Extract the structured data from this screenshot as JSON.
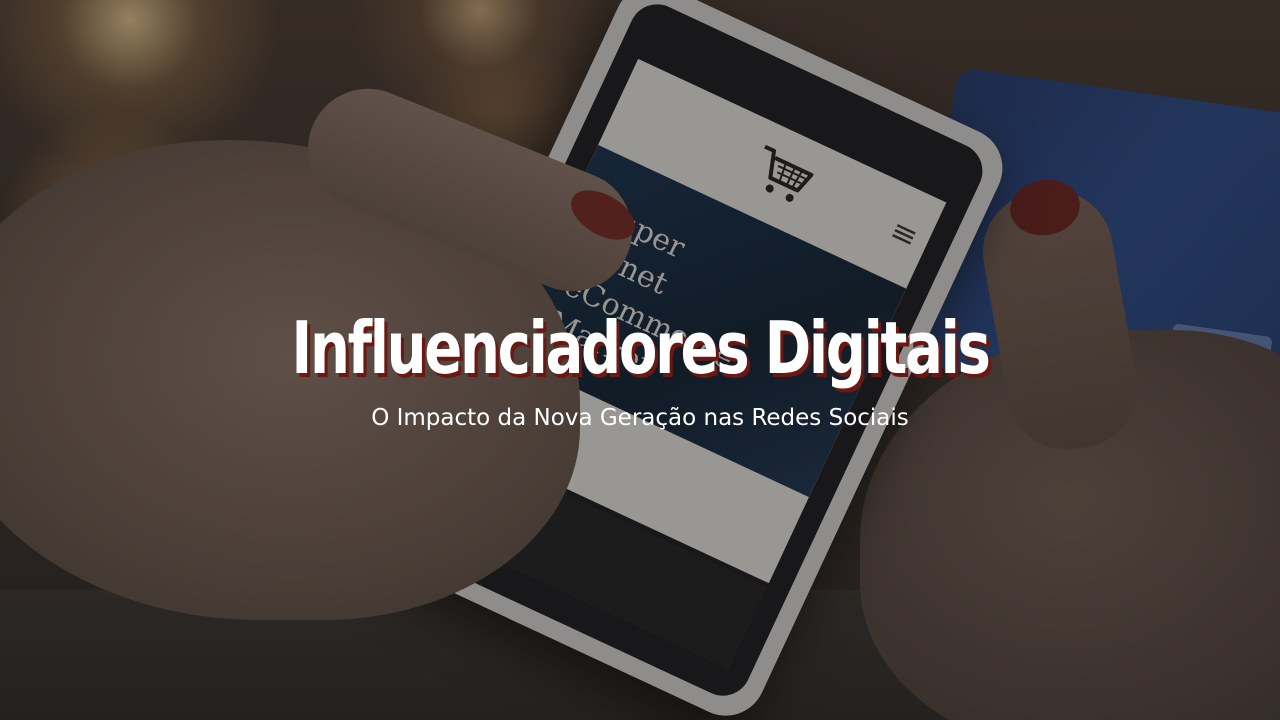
{
  "image": {
    "phone_screen": {
      "hero_text": "Super\n ernet\neCommerce\nMarket",
      "icons": [
        "shopping-cart-icon",
        "menu-icon"
      ]
    },
    "headline": "Influenciadores Digitais",
    "subtitle": "O Impacto da Nova Geração nas Redes Sociais"
  },
  "colors": {
    "headline_text": "#ffffff",
    "headline_shadow": "#6b1712",
    "card_blue": "#27509a"
  }
}
